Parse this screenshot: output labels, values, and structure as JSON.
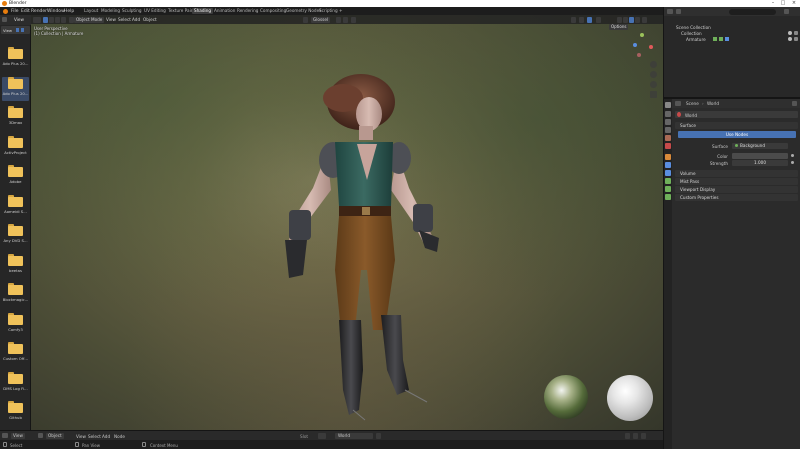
{
  "window": {
    "title": "Blender"
  },
  "menu": [
    "File",
    "Edit",
    "Render",
    "Window",
    "Help"
  ],
  "workspace_tabs": [
    "Layout",
    "Modeling",
    "Sculpting",
    "UV Editing",
    "Texture Paint",
    "Shading",
    "Animation",
    "Rendering",
    "Compositing",
    "Geometry Nodes",
    "Scripting"
  ],
  "active_tab": "Shading",
  "scene": {
    "label": "Scene",
    "view_layer": "ViewLayer"
  },
  "file_browser": {
    "view_label": "View",
    "items": [
      "Ado Plus 20...",
      "Ado Plus 20...",
      "3Dmax",
      "ActivProject",
      "Adobe",
      "Aomeidi S...",
      "Any DVD S...",
      "beetas",
      "Blockmagic...",
      "Comfy3",
      "Custom Off...",
      "DMS Log Fi...",
      "Github"
    ]
  },
  "viewport": {
    "mode": "Object Mode",
    "menus": [
      "View",
      "Select",
      "Add",
      "Object"
    ],
    "shading_label": "Glossel",
    "overlay_line1": "User Perspective",
    "overlay_line2": "(1) Collection | Armature",
    "options_label": "Options"
  },
  "footer": {
    "view": "View",
    "object": "Object",
    "menus": [
      "View",
      "Select",
      "Add",
      "Node"
    ],
    "slot": "Slot",
    "world": "World"
  },
  "statusbar": {
    "select": "Select",
    "pan": "Pan View",
    "context": "Context Menu"
  },
  "outliner": {
    "scene_collection": "Scene Collection",
    "collection": "Collection",
    "armature": "Armature"
  },
  "properties": {
    "breadcrumb_scene": "Scene",
    "breadcrumb_world": "World",
    "world_name": "World",
    "surface_header": "Surface",
    "use_nodes": "Use Nodes",
    "surface_label": "Surface",
    "surface_value": "Background",
    "color_label": "Color",
    "strength_label": "Strength",
    "strength_value": "1.000",
    "sections": [
      "Volume",
      "Mist Pass",
      "Viewport Display",
      "Custom Properties"
    ]
  },
  "colors": {
    "accent": "#4772b3",
    "orange": "#e87d0d",
    "folder": "#f0c25a",
    "bg": "#1d1d1d"
  }
}
